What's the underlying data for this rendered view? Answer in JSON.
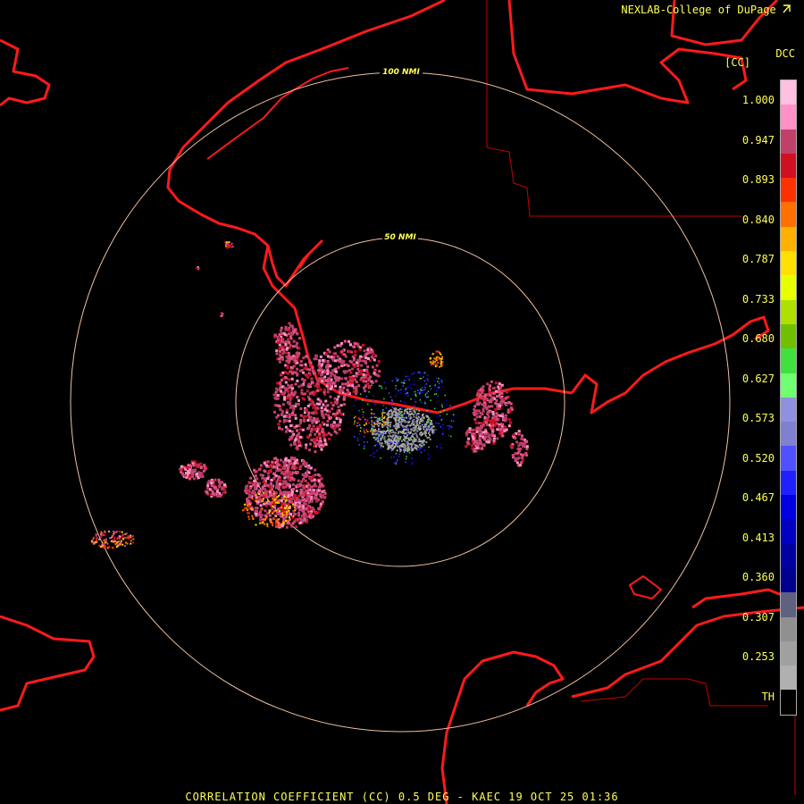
{
  "credit": "NEXLAB-College of DuPage",
  "credit_icon": "cursor-arrow-icon",
  "scale_title": "DCC",
  "scale_unit": "[CC]",
  "scale_ticks": [
    "1.000",
    "0.947",
    "0.893",
    "0.840",
    "0.787",
    "0.733",
    "0.680",
    "0.627",
    "0.573",
    "0.520",
    "0.467",
    "0.413",
    "0.360",
    "0.307",
    "0.253",
    "TH"
  ],
  "range_rings": [
    "100 NMI",
    "50 NMI"
  ],
  "footer": "CORRELATION COEFFICIENT (CC) 0.5 DEG - KAEC 19 OCT 25 01:36",
  "colors": {
    "background": "#000000",
    "text": "#ffff55",
    "coastline": "#ff1a1a",
    "boundary": "#c80000",
    "range_ring": "#f0c0a0",
    "colorbar": [
      "#ffc0e0",
      "#ff90c8",
      "#c0406a",
      "#d01020",
      "#ff3000",
      "#ff7000",
      "#ffb000",
      "#ffe000",
      "#e8ff00",
      "#b0e000",
      "#70c000",
      "#40e040",
      "#70ff70",
      "#9090e0",
      "#8080d0",
      "#5050ff",
      "#2020ff",
      "#0000e0",
      "#0000c0",
      "#0000a0",
      "#000090",
      "#606080",
      "#909090",
      "#a0a0a0",
      "#b0b0b0",
      "#000000"
    ]
  }
}
